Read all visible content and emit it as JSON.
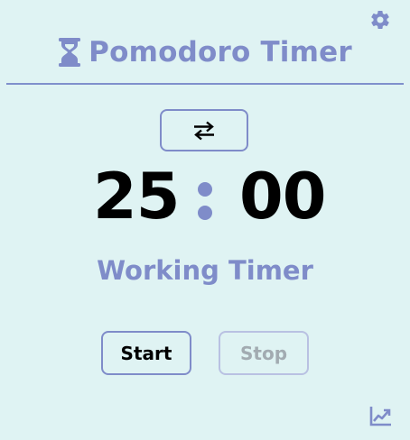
{
  "header": {
    "title": "Pomodoro Timer",
    "icon": "hourglass-icon"
  },
  "toolbar": {
    "settings_icon": "gear-icon",
    "swap_icon": "swap-arrows-icon",
    "stats_icon": "chart-line-icon"
  },
  "timer": {
    "minutes": "25",
    "seconds": "00",
    "mode_label": "Working Timer"
  },
  "controls": {
    "start_label": "Start",
    "stop_label": "Stop"
  },
  "colors": {
    "accent": "#7f8cc9",
    "background": "#dff3f3",
    "disabled_text": "#a2abb1"
  }
}
